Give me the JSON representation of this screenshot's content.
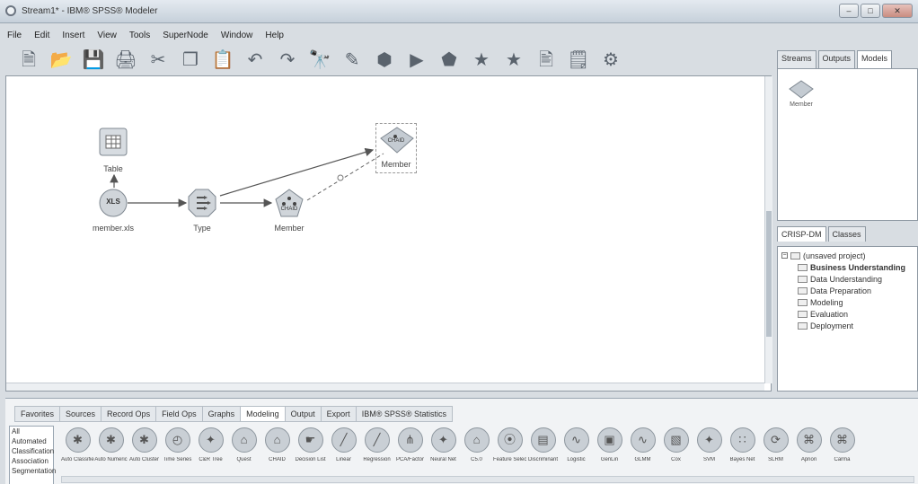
{
  "window": {
    "title": "Stream1* - IBM® SPSS® Modeler",
    "controls": [
      "–",
      "□",
      "✕"
    ]
  },
  "menu": [
    {
      "label": "File"
    },
    {
      "label": "Edit"
    },
    {
      "label": "Insert"
    },
    {
      "label": "View"
    },
    {
      "label": "Tools"
    },
    {
      "label": "SuperNode"
    },
    {
      "label": "Window"
    },
    {
      "label": "Help"
    }
  ],
  "toolbar": [
    {
      "name": "new-stream-icon",
      "glyph": "🗎"
    },
    {
      "name": "open-icon",
      "glyph": "📂"
    },
    {
      "name": "save-icon",
      "glyph": "💾"
    },
    {
      "name": "print-icon",
      "glyph": "🖨"
    },
    {
      "name": "cut-icon",
      "glyph": "✂"
    },
    {
      "name": "copy-icon",
      "glyph": "❐"
    },
    {
      "name": "paste-icon",
      "glyph": "📋"
    },
    {
      "name": "undo-icon",
      "glyph": "↶"
    },
    {
      "name": "redo-icon",
      "glyph": "↷"
    },
    {
      "name": "find-icon",
      "glyph": "🔭"
    },
    {
      "name": "edit-stream-icon",
      "glyph": "✎"
    },
    {
      "name": "stop-icon",
      "glyph": "⬢"
    },
    {
      "name": "run-icon",
      "glyph": "▶"
    },
    {
      "name": "run-selection-icon",
      "glyph": "⬟"
    },
    {
      "name": "supernode-icon",
      "glyph": "★"
    },
    {
      "name": "zoom-supernode-icon",
      "glyph": "★"
    },
    {
      "name": "annotation-icon",
      "glyph": "🖹"
    },
    {
      "name": "comment-icon",
      "glyph": "🗒"
    },
    {
      "name": "help-icon",
      "glyph": "⚙"
    }
  ],
  "canvas": {
    "nodes": [
      {
        "id": "table",
        "label": "Table"
      },
      {
        "id": "source",
        "label": "member.xls",
        "icon_text": "XLS"
      },
      {
        "id": "type",
        "label": "Type"
      },
      {
        "id": "model",
        "label": "Member",
        "icon_text": "CHAID"
      },
      {
        "id": "nugget",
        "label": "Member",
        "icon_text": "CHAID"
      }
    ]
  },
  "right_panel": {
    "tabs": [
      {
        "label": "Streams"
      },
      {
        "label": "Outputs"
      },
      {
        "label": "Models",
        "active": true
      }
    ],
    "model_item": "Member",
    "crisp_tabs": [
      {
        "label": "CRISP-DM",
        "active": true
      },
      {
        "label": "Classes"
      }
    ],
    "tree": {
      "root": "(unsaved project)",
      "children": [
        {
          "label": "Business Understanding",
          "bold": true
        },
        {
          "label": "Data Understanding"
        },
        {
          "label": "Data Preparation"
        },
        {
          "label": "Modeling"
        },
        {
          "label": "Evaluation"
        },
        {
          "label": "Deployment"
        }
      ]
    }
  },
  "palette": {
    "tabs": [
      {
        "label": "Favorites"
      },
      {
        "label": "Sources"
      },
      {
        "label": "Record Ops"
      },
      {
        "label": "Field Ops"
      },
      {
        "label": "Graphs"
      },
      {
        "label": "Modeling",
        "active": true
      },
      {
        "label": "Output"
      },
      {
        "label": "Export"
      },
      {
        "label": "IBM® SPSS® Statistics"
      }
    ],
    "categories": [
      "All",
      "Automated",
      "Classification",
      "Association",
      "Segmentation"
    ],
    "nodes": [
      {
        "label": "Auto Classifier",
        "glyph": "✱"
      },
      {
        "label": "Auto Numeric",
        "glyph": "✱"
      },
      {
        "label": "Auto Cluster",
        "glyph": "✱"
      },
      {
        "label": "Time Series",
        "glyph": "◴"
      },
      {
        "label": "C&R Tree",
        "glyph": "✦"
      },
      {
        "label": "Quest",
        "glyph": "⌂"
      },
      {
        "label": "CHAID",
        "glyph": "⌂"
      },
      {
        "label": "Decision List",
        "glyph": "☛"
      },
      {
        "label": "Linear",
        "glyph": "╱"
      },
      {
        "label": "Regression",
        "glyph": "╱"
      },
      {
        "label": "PCA/Factor",
        "glyph": "⋔"
      },
      {
        "label": "Neural Net",
        "glyph": "✦"
      },
      {
        "label": "C5.0",
        "glyph": "⌂"
      },
      {
        "label": "Feature Selection",
        "glyph": "⦿"
      },
      {
        "label": "Discriminant",
        "glyph": "▤"
      },
      {
        "label": "Logistic",
        "glyph": "∿"
      },
      {
        "label": "GenLin",
        "glyph": "▣"
      },
      {
        "label": "GLMM",
        "glyph": "∿"
      },
      {
        "label": "Cox",
        "glyph": "▧"
      },
      {
        "label": "SVM",
        "glyph": "✦"
      },
      {
        "label": "Bayes Net",
        "glyph": "∷"
      },
      {
        "label": "SLRM",
        "glyph": "⟳"
      },
      {
        "label": "Apriori",
        "glyph": "⌘"
      },
      {
        "label": "Carma",
        "glyph": "⌘"
      }
    ]
  },
  "colors": {
    "canvas_bg": "#ffffff",
    "node_fill": "#d0d5da",
    "connector": "#555555"
  }
}
